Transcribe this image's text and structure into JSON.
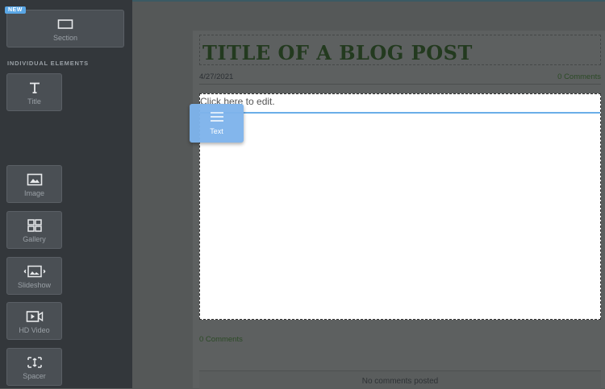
{
  "sidebar": {
    "new_badge": "NEW",
    "section_tile": {
      "label": "Section",
      "icon": "section-icon"
    },
    "section_heading": "INDIVIDUAL ELEMENTS",
    "elements": [
      {
        "label": "Title",
        "icon": "title-icon"
      },
      {
        "label": "Image",
        "icon": "image-icon"
      },
      {
        "label": "Gallery",
        "icon": "gallery-icon"
      },
      {
        "label": "Slideshow",
        "icon": "slideshow-icon"
      },
      {
        "label": "HD Video",
        "icon": "video-icon"
      },
      {
        "label": "Spacer",
        "icon": "spacer-icon"
      }
    ]
  },
  "post": {
    "title": "TITLE OF A BLOG POST",
    "date": "4/27/2021",
    "comments_count": "0 Comments",
    "text_placeholder": "Click here to edit.",
    "footer_comments": "0 Comments",
    "no_comments": "No comments posted"
  },
  "drag_tile": {
    "label": "Text",
    "icon": "text-lines-icon"
  },
  "colors": {
    "accent": "#7eb4ec",
    "title_green": "#233a1f",
    "sidebar_bg": "#33373b"
  }
}
